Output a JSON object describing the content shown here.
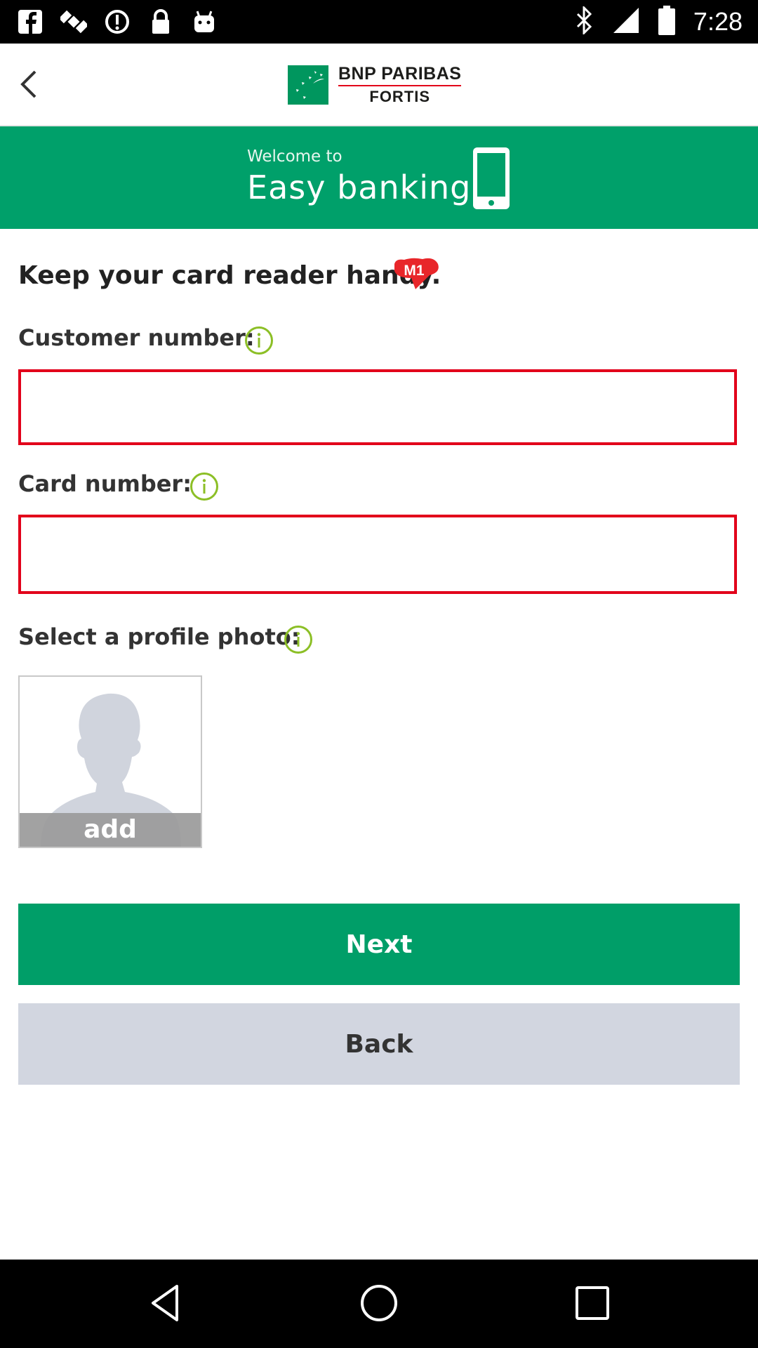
{
  "status_bar": {
    "time": "7:28",
    "icons": [
      "facebook-icon",
      "satellite-icon",
      "sync-icon",
      "lock-icon",
      "android-icon",
      "bluetooth-icon",
      "signal-icon",
      "battery-icon"
    ]
  },
  "header": {
    "logo_line1": "BNP PARIBAS",
    "logo_line2": "FORTIS"
  },
  "banner": {
    "welcome": "Welcome to",
    "title": "Easy banking"
  },
  "form": {
    "intro": "Keep your card reader handy.",
    "badge": "M1",
    "customer_label": "Customer number:",
    "customer_value": "",
    "card_label": "Card number:",
    "card_value": "",
    "photo_label": "Select a profile photo:",
    "photo_add": "add"
  },
  "buttons": {
    "next": "Next",
    "back": "Back"
  },
  "colors": {
    "brand_green": "#00a06a",
    "button_green": "#009e68",
    "field_border": "#e2001a",
    "info_icon": "#8cbf26",
    "back_button": "#d2d6e0"
  }
}
